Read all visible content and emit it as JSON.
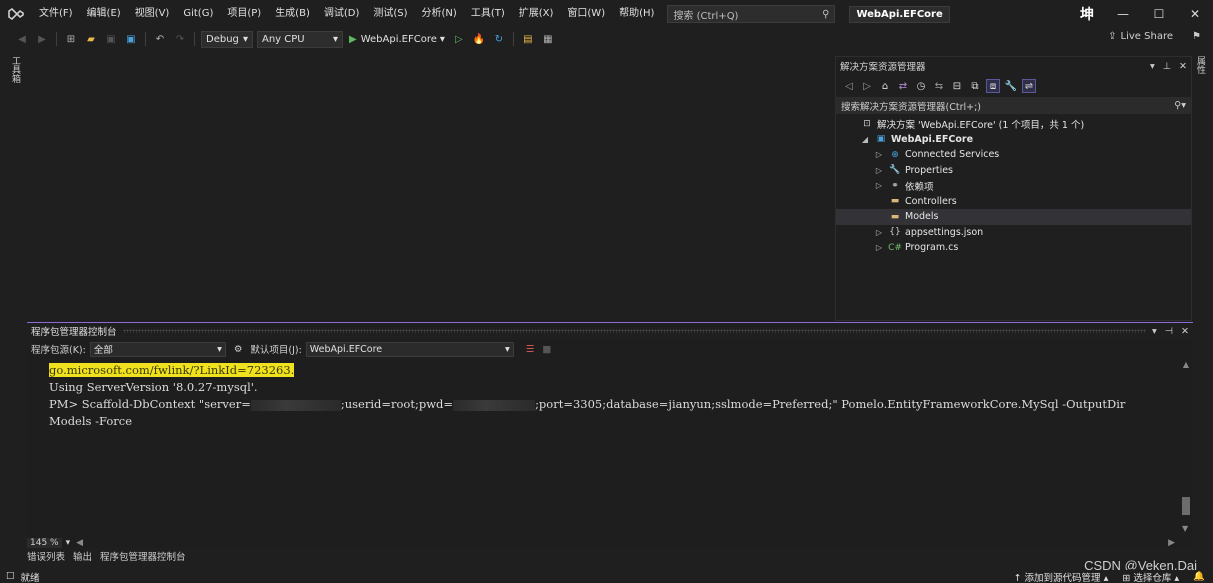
{
  "menu": [
    "文件(F)",
    "编辑(E)",
    "视图(V)",
    "Git(G)",
    "项目(P)",
    "生成(B)",
    "调试(D)",
    "测试(S)",
    "分析(N)",
    "工具(T)",
    "扩展(X)",
    "窗口(W)",
    "帮助(H)"
  ],
  "search": {
    "placeholder": "搜索 (Ctrl+Q)"
  },
  "window_title": "WebApi.EFCore",
  "user_char": "坤",
  "toolbar": {
    "config": "Debug",
    "platform": "Any CPU",
    "run_target": "WebApi.EFCore",
    "live_share": "Live Share"
  },
  "left_rail": "工具箱",
  "right_rail": "属性",
  "solution_explorer": {
    "title": "解决方案资源管理器",
    "search_placeholder": "搜索解决方案资源管理器(Ctrl+;)",
    "tree": [
      {
        "label": "解决方案 'WebApi.EFCore' (1 个项目，共 1 个)",
        "indent": 0,
        "expander": "",
        "icon": "solution-icon",
        "bold": false
      },
      {
        "label": "WebApi.EFCore",
        "indent": 1,
        "expander": "◢",
        "icon": "project-icon",
        "bold": true
      },
      {
        "label": "Connected Services",
        "indent": 2,
        "expander": "▷",
        "icon": "connected-services-icon",
        "bold": false
      },
      {
        "label": "Properties",
        "indent": 2,
        "expander": "▷",
        "icon": "properties-icon",
        "bold": false
      },
      {
        "label": "依赖项",
        "indent": 2,
        "expander": "▷",
        "icon": "dependencies-icon",
        "bold": false
      },
      {
        "label": "Controllers",
        "indent": 2,
        "expander": "",
        "icon": "folder-icon",
        "bold": false
      },
      {
        "label": "Models",
        "indent": 2,
        "expander": "",
        "icon": "folder-icon",
        "bold": false,
        "selected": true
      },
      {
        "label": "appsettings.json",
        "indent": 2,
        "expander": "▷",
        "icon": "json-file-icon",
        "bold": false
      },
      {
        "label": "Program.cs",
        "indent": 2,
        "expander": "▷",
        "icon": "csharp-file-icon",
        "bold": false
      }
    ]
  },
  "pmc": {
    "title": "程序包管理器控制台",
    "source_label": "程序包源(K):",
    "source_value": "全部",
    "default_project_label": "默认项目(J):",
    "default_project_value": "WebApi.EFCore",
    "lines": {
      "link": "go.microsoft.com/fwlink/?LinkId=723263.",
      "server_version": "Using ServerVersion '8.0.27-mysql'.",
      "cmd_part1": "PM> Scaffold-DbContext \"server=",
      "cmd_part2": ";userid=root;pwd=",
      "cmd_part3": ";port=3305;database=jianyun;sslmode=Preferred;\" Pomelo.EntityFrameworkCore.MySql -OutputDir",
      "cmd_part4": "Models -Force"
    },
    "zoom": "145 %"
  },
  "bottom_tabs": [
    "错误列表",
    "输出",
    "程序包管理器控制台"
  ],
  "status": {
    "ready": "就绪",
    "add_source_control": "添加到源代码管理",
    "select_repo": "选择仓库"
  },
  "watermark": "CSDN @Veken.Dai"
}
